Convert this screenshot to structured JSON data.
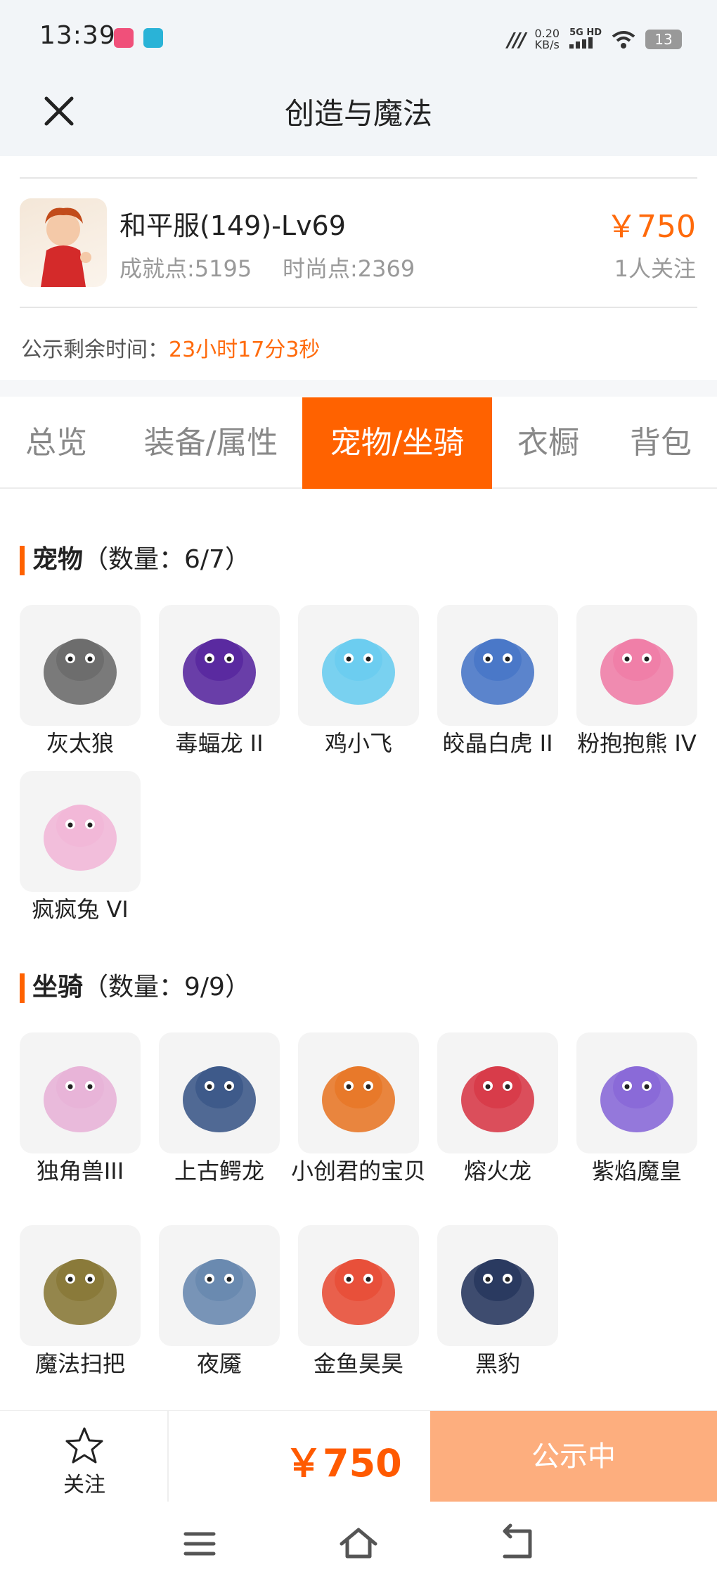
{
  "status_bar": {
    "time": "13:39",
    "speed_value": "0.20",
    "speed_unit": "KB/s",
    "network": "5G HD",
    "battery": "13",
    "icons": [
      "app-icon-pink",
      "app-icon-blue",
      "hd-icon",
      "signal-icon",
      "wifi-icon",
      "battery-icon"
    ]
  },
  "header": {
    "title": "创造与魔法",
    "close_icon": "close-icon"
  },
  "account": {
    "name": "和平服(149)-Lv69",
    "achievement": "成就点:5195",
    "fashion": "时尚点:2369",
    "price": "￥750",
    "followers": "1人关注",
    "timer_label": "公示剩余时间：",
    "timer_value": "23小时17分3秒"
  },
  "tabs": [
    {
      "label": "总览",
      "active": false
    },
    {
      "label": "装备/属性",
      "active": false
    },
    {
      "label": "宠物/坐骑",
      "active": true
    },
    {
      "label": "衣橱",
      "active": false
    },
    {
      "label": "背包",
      "active": false
    }
  ],
  "pets": {
    "title": "宠物",
    "count": "（数量：6/7）",
    "items": [
      {
        "label": "灰太狼",
        "color": "#6d6d6d"
      },
      {
        "label": "毒蝠龙 II",
        "color": "#5a2aa0"
      },
      {
        "label": "鸡小飞",
        "color": "#6ccdf0"
      },
      {
        "label": "皎晶白虎 II",
        "color": "#4a78c8"
      },
      {
        "label": "粉抱抱熊 IV",
        "color": "#f07fa8"
      },
      {
        "label": "疯疯兔 VI",
        "color": "#f2b8d8"
      }
    ]
  },
  "mounts": {
    "title": "坐骑",
    "count": "（数量：9/9）",
    "items": [
      {
        "label": "独角兽III",
        "color": "#e8b4d8"
      },
      {
        "label": "上古鳄龙",
        "color": "#3e5a8a"
      },
      {
        "label": "小创君的宝贝",
        "color": "#e8792a"
      },
      {
        "label": "熔火龙",
        "color": "#d83c4a"
      },
      {
        "label": "紫焰魔皇",
        "color": "#8a6ad8"
      },
      {
        "label": "魔法扫把",
        "color": "#8a7a3a"
      },
      {
        "label": "夜魇",
        "color": "#6a8ab0"
      },
      {
        "label": "金鱼昊昊",
        "color": "#e8503a"
      },
      {
        "label": "黑豹",
        "color": "#2a3a60"
      }
    ]
  },
  "bottom_bar": {
    "follow_label": "关注",
    "follow_icon": "star-icon",
    "price": "￥750",
    "status_label": "公示中"
  },
  "nav": {
    "icons": [
      "menu-icon",
      "home-icon",
      "back-icon"
    ]
  },
  "colors": {
    "accent": "#ff6200",
    "price": "#ff6a0b",
    "status_button": "#fdae7e"
  }
}
